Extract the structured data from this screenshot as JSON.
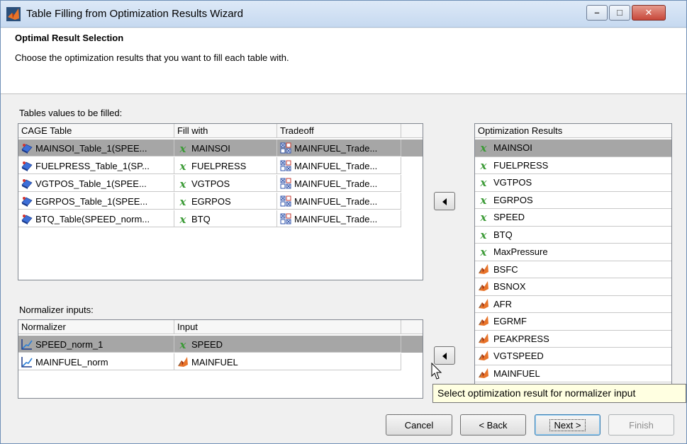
{
  "window": {
    "title": "Table Filling from Optimization Results Wizard",
    "controls": {
      "minimize": "–",
      "maximize": "□",
      "close": "✕"
    }
  },
  "header": {
    "title": "Optimal Result Selection",
    "description": "Choose the optimization results that you want to fill each table with."
  },
  "tables_section": {
    "label": "Tables values to be filled:",
    "columns": [
      "CAGE Table",
      "Fill with",
      "Tradeoff"
    ],
    "rows": [
      {
        "table": "MAINSOI_Table_1(SPEE...",
        "fill": "MAINSOI",
        "tradeoff": "MAINFUEL_Trade...",
        "selected": true
      },
      {
        "table": "FUELPRESS_Table_1(SP...",
        "fill": "FUELPRESS",
        "tradeoff": "MAINFUEL_Trade...",
        "selected": false
      },
      {
        "table": "VGTPOS_Table_1(SPEE...",
        "fill": "VGTPOS",
        "tradeoff": "MAINFUEL_Trade...",
        "selected": false
      },
      {
        "table": "EGRPOS_Table_1(SPEE...",
        "fill": "EGRPOS",
        "tradeoff": "MAINFUEL_Trade...",
        "selected": false
      },
      {
        "table": "BTQ_Table(SPEED_norm...",
        "fill": "BTQ",
        "tradeoff": "MAINFUEL_Trade...",
        "selected": false
      }
    ]
  },
  "normalizer_section": {
    "label": "Normalizer inputs:",
    "columns": [
      "Normalizer",
      "Input"
    ],
    "rows": [
      {
        "normalizer": "SPEED_norm_1",
        "input": "SPEED",
        "input_icon": "x-variable-icon",
        "selected": true
      },
      {
        "normalizer": "MAINFUEL_norm",
        "input": "MAINFUEL",
        "input_icon": "model-icon",
        "selected": false
      }
    ]
  },
  "results": {
    "header": "Optimization Results",
    "items": [
      {
        "label": "MAINSOI",
        "icon": "x-variable-icon",
        "selected": true
      },
      {
        "label": "FUELPRESS",
        "icon": "x-variable-icon",
        "selected": false
      },
      {
        "label": "VGTPOS",
        "icon": "x-variable-icon",
        "selected": false
      },
      {
        "label": "EGRPOS",
        "icon": "x-variable-icon",
        "selected": false
      },
      {
        "label": "SPEED",
        "icon": "x-variable-icon",
        "selected": false
      },
      {
        "label": "BTQ",
        "icon": "x-variable-icon",
        "selected": false
      },
      {
        "label": "MaxPressure",
        "icon": "x-variable-icon",
        "selected": false
      },
      {
        "label": "BSFC",
        "icon": "model-icon",
        "selected": false
      },
      {
        "label": "BSNOX",
        "icon": "model-icon",
        "selected": false
      },
      {
        "label": "AFR",
        "icon": "model-icon",
        "selected": false
      },
      {
        "label": "EGRMF",
        "icon": "model-icon",
        "selected": false
      },
      {
        "label": "PEAKPRESS",
        "icon": "model-icon",
        "selected": false
      },
      {
        "label": "VGTSPEED",
        "icon": "model-icon",
        "selected": false
      },
      {
        "label": "MAINFUEL",
        "icon": "model-icon",
        "selected": false
      }
    ]
  },
  "tooltip": "Select optimization result for normalizer input",
  "buttons": {
    "cancel": "Cancel",
    "back": "< Back",
    "next": "Next >",
    "finish": "Finish"
  },
  "colors": {
    "selection": "#a6a6a6",
    "variable_green": "#3a9a35",
    "tooltip_bg": "#ffffe1",
    "title_gradient": "#c6d9f0"
  }
}
